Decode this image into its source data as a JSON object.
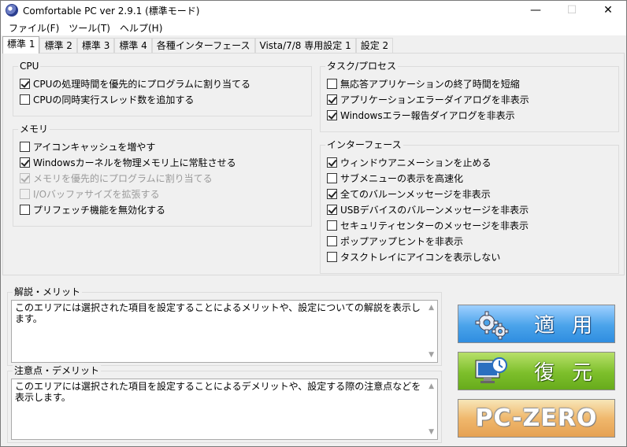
{
  "window": {
    "title": "Comfortable PC ver 2.9.1 (標準モード)",
    "minimize": "—",
    "maximize": "☐",
    "close": "✕"
  },
  "menu": [
    "ファイル(F)",
    "ツール(T)",
    "ヘルプ(H)"
  ],
  "tabs": [
    {
      "label": "標準 1",
      "active": true
    },
    {
      "label": "標準 2",
      "active": false
    },
    {
      "label": "標準 3",
      "active": false
    },
    {
      "label": "標準 4",
      "active": false
    },
    {
      "label": "各種インターフェース",
      "active": false
    },
    {
      "label": "Vista/7/8 専用設定 1",
      "active": false
    },
    {
      "label": "設定 2",
      "active": false
    }
  ],
  "cpu": {
    "title": "CPU",
    "items": [
      {
        "label": "CPUの処理時間を優先的にプログラムに割り当てる",
        "checked": true,
        "enabled": true
      },
      {
        "label": "CPUの同時実行スレッド数を追加する",
        "checked": false,
        "enabled": true
      }
    ]
  },
  "memory": {
    "title": "メモリ",
    "items": [
      {
        "label": "アイコンキャッシュを増やす",
        "checked": false,
        "enabled": true
      },
      {
        "label": "Windowsカーネルを物理メモリ上に常駐させる",
        "checked": true,
        "enabled": true
      },
      {
        "label": "メモリを優先的にプログラムに割り当てる",
        "checked": true,
        "enabled": false
      },
      {
        "label": "I/Oバッファサイズを拡張する",
        "checked": false,
        "enabled": false
      },
      {
        "label": "プリフェッチ機能を無効化する",
        "checked": false,
        "enabled": true
      }
    ]
  },
  "task": {
    "title": "タスク/プロセス",
    "items": [
      {
        "label": "無応答アプリケーションの終了時間を短縮",
        "checked": false,
        "enabled": true
      },
      {
        "label": "アプリケーションエラーダイアログを非表示",
        "checked": true,
        "enabled": true
      },
      {
        "label": "Windowsエラー報告ダイアログを非表示",
        "checked": true,
        "enabled": true
      }
    ]
  },
  "interface": {
    "title": "インターフェース",
    "items": [
      {
        "label": "ウィンドウアニメーションを止める",
        "checked": true,
        "enabled": true
      },
      {
        "label": "サブメニューの表示を高速化",
        "checked": false,
        "enabled": true
      },
      {
        "label": "全てのバルーンメッセージを非表示",
        "checked": true,
        "enabled": true
      },
      {
        "label": "USBデバイスのバルーンメッセージを非表示",
        "checked": true,
        "enabled": true
      },
      {
        "label": "セキュリティセンターのメッセージを非表示",
        "checked": false,
        "enabled": true
      },
      {
        "label": "ポップアップヒントを非表示",
        "checked": false,
        "enabled": true
      },
      {
        "label": "タスクトレイにアイコンを表示しない",
        "checked": false,
        "enabled": true
      }
    ]
  },
  "explanation": {
    "title": "解説・メリット",
    "text": "このエリアには選択された項目を設定することによるメリットや、設定についての解説を表示します。"
  },
  "caution": {
    "title": "注意点・デメリット",
    "text": "このエリアには選択された項目を設定することによるデメリットや、設定する際の注意点などを表示します。"
  },
  "buttons": {
    "apply": "適用",
    "restore": "復元",
    "pczero": "PC-ZERO"
  },
  "icons": {
    "apply": "gears-icon",
    "restore": "restore-monitor-icon",
    "app": "app-icon"
  }
}
